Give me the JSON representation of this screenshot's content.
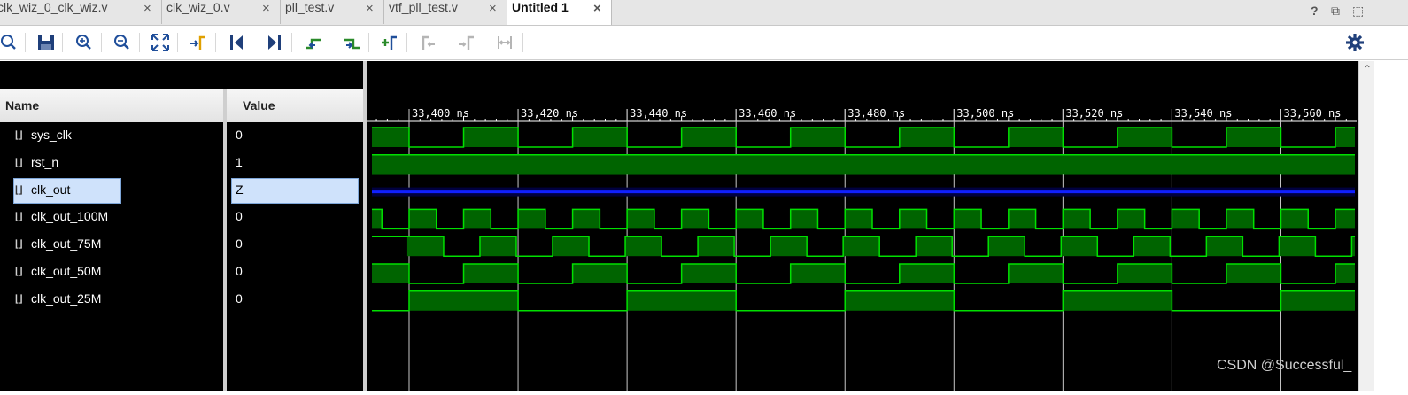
{
  "tabs": [
    {
      "label": "clk_wiz_0_clk_wiz.v",
      "active": false
    },
    {
      "label": "clk_wiz_0.v",
      "active": false
    },
    {
      "label": "pll_test.v",
      "active": false
    },
    {
      "label": "vtf_pll_test.v",
      "active": false
    },
    {
      "label": "Untitled 1",
      "active": true
    }
  ],
  "tab_close_glyph": "×",
  "window_controls": {
    "help": "?",
    "restore": "⧉",
    "float": "⬚"
  },
  "toolbar_icons": [
    "search-icon",
    "save-icon",
    "zoom-in-icon",
    "zoom-out-icon",
    "zoom-fit-icon",
    "go-to-cursor-icon",
    "go-to-time-zero-icon",
    "go-to-last-time-icon",
    "previous-transition-icon",
    "next-transition-icon",
    "add-marker-icon",
    "previous-marker-icon",
    "next-marker-icon",
    "swap-cursors-icon",
    "settings-gear-icon"
  ],
  "columns": {
    "name": "Name",
    "value": "Value"
  },
  "signals": [
    {
      "name": "sys_clk",
      "value": "0",
      "selected": false
    },
    {
      "name": "rst_n",
      "value": "1",
      "selected": false
    },
    {
      "name": "clk_out",
      "value": "Z",
      "selected": true
    },
    {
      "name": "clk_out_100M",
      "value": "0",
      "selected": false
    },
    {
      "name": "clk_out_75M",
      "value": "0",
      "selected": false
    },
    {
      "name": "clk_out_50M",
      "value": "0",
      "selected": false
    },
    {
      "name": "clk_out_25M",
      "value": "0",
      "selected": false
    }
  ],
  "timeline": {
    "unit": "ns",
    "labels": [
      "33,400 ns",
      "33,420 ns",
      "33,440 ns",
      "33,460 ns",
      "33,480 ns",
      "33,500 ns",
      "33,520 ns",
      "33,540 ns",
      "33,560 ns"
    ],
    "label_times": [
      33400,
      33420,
      33440,
      33460,
      33480,
      33500,
      33520,
      33540,
      33560
    ],
    "view_start_ns": 33392.2,
    "view_end_ns": 33573.9
  },
  "waveforms": [
    {
      "name": "sys_clk",
      "kind": "clock",
      "period_ns": 20,
      "high_phase_ns": 10
    },
    {
      "name": "rst_n",
      "kind": "constant",
      "level": 1
    },
    {
      "name": "clk_out",
      "kind": "highz"
    },
    {
      "name": "clk_out_100M",
      "kind": "clock",
      "period_ns": 10,
      "high_phase_ns": 0
    },
    {
      "name": "clk_out_75M",
      "kind": "clock",
      "period_ns": 13.333,
      "high_phase_ns": 0.5
    },
    {
      "name": "clk_out_50M",
      "kind": "clock",
      "period_ns": 20,
      "high_phase_ns": 10
    },
    {
      "name": "clk_out_25M",
      "kind": "clock",
      "period_ns": 40,
      "high_phase_ns": 0
    }
  ],
  "colors": {
    "wave_line": "#00e000",
    "wave_fill": "#006400",
    "highz": "#1020ff",
    "grid": "#c8c8c8",
    "background": "#000000"
  },
  "watermark": "CSDN @Successful_"
}
